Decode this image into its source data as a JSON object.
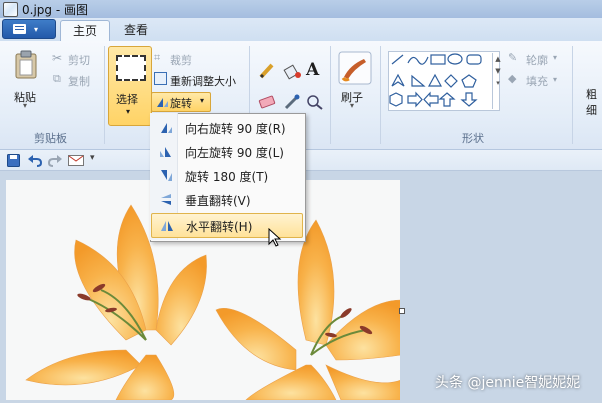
{
  "window": {
    "title": "0.jpg - 画图"
  },
  "tabs": {
    "file_arrow": "▾",
    "home": "主页",
    "view": "查看"
  },
  "clipboard": {
    "paste": "粘贴",
    "cut": "剪切",
    "copy": "复制",
    "group": "剪贴板"
  },
  "image": {
    "select": "选择",
    "crop": "裁剪",
    "resize": "重新调整大小",
    "rotate": "旋转"
  },
  "tools": {
    "text_glyph": "A"
  },
  "brushes": {
    "label": "刷子"
  },
  "shapes": {
    "outline": "轮廓",
    "fill": "填充",
    "group": "形状"
  },
  "size": {
    "label_1": "粗",
    "label_2": "细"
  },
  "rotate_menu": {
    "items": [
      "向右旋转 90 度(R)",
      "向左旋转 90 度(L)",
      "旋转 180 度(T)",
      "垂直翻转(V)",
      "水平翻转(H)"
    ],
    "highlighted_index": 4
  },
  "watermark": "头条 @jennie智妮妮妮",
  "colors": {
    "accent": "#2c62b0",
    "highlight": "#ffe29a",
    "petal": "#f8b24a"
  }
}
